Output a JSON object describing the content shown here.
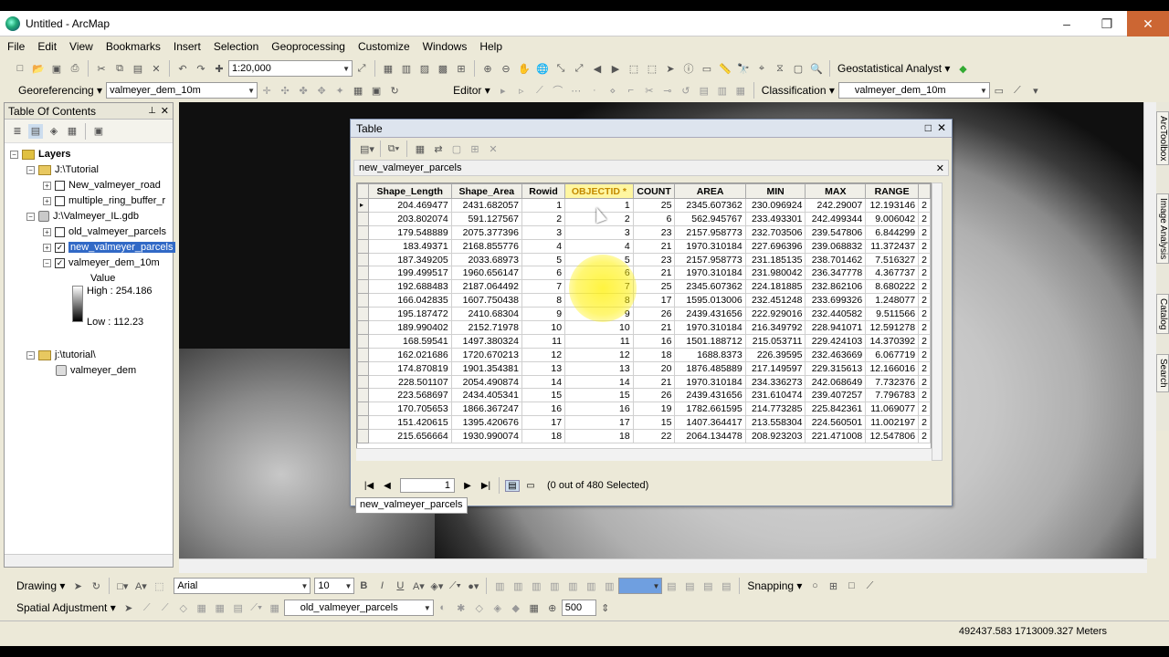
{
  "window": {
    "title": "Untitled - ArcMap",
    "minimize": "–",
    "restore": "❐",
    "close": "✕"
  },
  "menu": [
    "File",
    "Edit",
    "View",
    "Bookmarks",
    "Insert",
    "Selection",
    "Geoprocessing",
    "Customize",
    "Windows",
    "Help"
  ],
  "toolbar1": {
    "scale": "1:20,000",
    "geostat": "Geostatistical Analyst ▾"
  },
  "toolbar2": {
    "georef": "Georeferencing ▾",
    "georef_layer": "valmeyer_dem_10m",
    "editor": "Editor ▾",
    "classification": "Classification ▾",
    "class_layer": "valmeyer_dem_10m"
  },
  "toc": {
    "title": "Table Of Contents",
    "pin": "⊥",
    "close": "✕",
    "layers_label": "Layers",
    "tutorial_folder": "J:\\Tutorial",
    "new_road": "New_valmeyer_road",
    "ring_buffer": "multiple_ring_buffer_r",
    "gdb": "J:\\Valmeyer_IL.gdb",
    "old_parcels": "old_valmeyer_parcels",
    "new_parcels": "new_valmeyer_parcels",
    "dem": "valmeyer_dem_10m",
    "value_label": "Value",
    "high": "High : 254.186",
    "low": "Low : 112.23",
    "tutorial2": "j:\\tutorial\\",
    "dem2": "valmeyer_dem"
  },
  "side_tabs": [
    "ArcToolbox",
    "Image Analysis",
    "Catalog",
    "Search"
  ],
  "table_window": {
    "title": "Table",
    "layer_tab": "new_valmeyer_parcels",
    "bottom_tab": "new_valmeyer_parcels",
    "page": "1",
    "selection": "(0 out of 480 Selected)",
    "columns": [
      "Shape_Length",
      "Shape_Area",
      "Rowid",
      "OBJECTID *",
      "COUNT",
      "AREA",
      "MIN",
      "MAX",
      "RANGE"
    ],
    "rows": [
      [
        "204.469477",
        "2431.682057",
        "1",
        "1",
        "25",
        "2345.607362",
        "230.096924",
        "242.29007",
        "12.193146"
      ],
      [
        "203.802074",
        "591.127567",
        "2",
        "2",
        "6",
        "562.945767",
        "233.493301",
        "242.499344",
        "9.006042"
      ],
      [
        "179.548889",
        "2075.377396",
        "3",
        "3",
        "23",
        "2157.958773",
        "232.703506",
        "239.547806",
        "6.844299"
      ],
      [
        "183.49371",
        "2168.855776",
        "4",
        "4",
        "21",
        "1970.310184",
        "227.696396",
        "239.068832",
        "11.372437"
      ],
      [
        "187.349205",
        "2033.68973",
        "5",
        "5",
        "23",
        "2157.958773",
        "231.185135",
        "238.701462",
        "7.516327"
      ],
      [
        "199.499517",
        "1960.656147",
        "6",
        "6",
        "21",
        "1970.310184",
        "231.980042",
        "236.347778",
        "4.367737"
      ],
      [
        "192.688483",
        "2187.064492",
        "7",
        "7",
        "25",
        "2345.607362",
        "224.181885",
        "232.862106",
        "8.680222"
      ],
      [
        "166.042835",
        "1607.750438",
        "8",
        "8",
        "17",
        "1595.013006",
        "232.451248",
        "233.699326",
        "1.248077"
      ],
      [
        "195.187472",
        "2410.68304",
        "9",
        "9",
        "26",
        "2439.431656",
        "222.929016",
        "232.440582",
        "9.511566"
      ],
      [
        "189.990402",
        "2152.71978",
        "10",
        "10",
        "21",
        "1970.310184",
        "216.349792",
        "228.941071",
        "12.591278"
      ],
      [
        "168.59541",
        "1497.380324",
        "11",
        "11",
        "16",
        "1501.188712",
        "215.053711",
        "229.424103",
        "14.370392"
      ],
      [
        "162.021686",
        "1720.670213",
        "12",
        "12",
        "18",
        "1688.8373",
        "226.39595",
        "232.463669",
        "6.067719"
      ],
      [
        "174.870819",
        "1901.354381",
        "13",
        "13",
        "20",
        "1876.485889",
        "217.149597",
        "229.315613",
        "12.166016"
      ],
      [
        "228.501107",
        "2054.490874",
        "14",
        "14",
        "21",
        "1970.310184",
        "234.336273",
        "242.068649",
        "7.732376"
      ],
      [
        "223.568697",
        "2434.405341",
        "15",
        "15",
        "26",
        "2439.431656",
        "231.610474",
        "239.407257",
        "7.796783"
      ],
      [
        "170.705653",
        "1866.367247",
        "16",
        "16",
        "19",
        "1782.661595",
        "214.773285",
        "225.842361",
        "11.069077"
      ],
      [
        "151.420615",
        "1395.420676",
        "17",
        "17",
        "15",
        "1407.364417",
        "213.558304",
        "224.560501",
        "11.002197"
      ],
      [
        "215.656664",
        "1930.990074",
        "18",
        "18",
        "22",
        "2064.134478",
        "208.923203",
        "221.471008",
        "12.547806"
      ]
    ]
  },
  "draw_toolbar": {
    "drawing": "Drawing ▾",
    "font": "Arial",
    "size": "10",
    "snapping": "Snapping ▾"
  },
  "spatial_toolbar": {
    "label": "Spatial Adjustment ▾",
    "layer": "old_valmeyer_parcels",
    "value": "500"
  },
  "status": {
    "coords": "492437.583  1713009.327 Meters"
  }
}
